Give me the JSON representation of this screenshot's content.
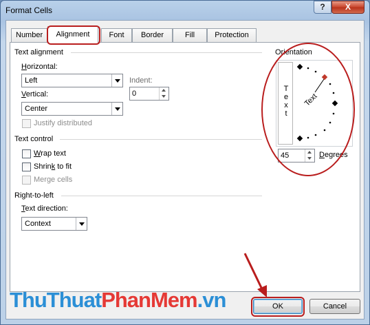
{
  "window": {
    "title": "Format Cells",
    "help_label": "?",
    "close_label": "X"
  },
  "tabs": [
    {
      "label": "Number"
    },
    {
      "label": "Alignment"
    },
    {
      "label": "Font"
    },
    {
      "label": "Border"
    },
    {
      "label": "Fill"
    },
    {
      "label": "Protection"
    }
  ],
  "active_tab": "Alignment",
  "text_alignment": {
    "group_title": "Text alignment",
    "horizontal_label_u": "H",
    "horizontal_label_rest": "orizontal:",
    "horizontal_value": "Left",
    "indent_label": "Indent:",
    "indent_value": "0",
    "vertical_label_u": "V",
    "vertical_label_rest": "ertical:",
    "vertical_value": "Center",
    "justify_distributed_label": "Justify distributed"
  },
  "text_control": {
    "group_title": "Text control",
    "wrap_u": "W",
    "wrap_rest": "rap text",
    "shrink_pre": "Shrin",
    "shrink_u": "k",
    "shrink_rest": " to fit",
    "merge_label": "Merge cells"
  },
  "rtl": {
    "group_title": "Right-to-left",
    "direction_label_u": "T",
    "direction_label_rest": "ext direction:",
    "direction_value": "Context"
  },
  "orientation": {
    "group_title": "Orientation",
    "vertical_letters": [
      "T",
      "e",
      "x",
      "t"
    ],
    "dial_text": "Text",
    "degrees_value": "45",
    "degrees_label_u": "D",
    "degrees_label_rest": "egrees",
    "accent_color": "#c0392b"
  },
  "buttons": {
    "ok_label": "OK",
    "cancel_label": "Cancel"
  },
  "watermark": {
    "part1": "ThuThuat",
    "part2": "PhanMem",
    "part3": ".vn",
    "color1": "#2b8fd6",
    "color2": "#e53935",
    "color3": "#2b8fd6"
  },
  "annotation_color": "#b91d1d"
}
